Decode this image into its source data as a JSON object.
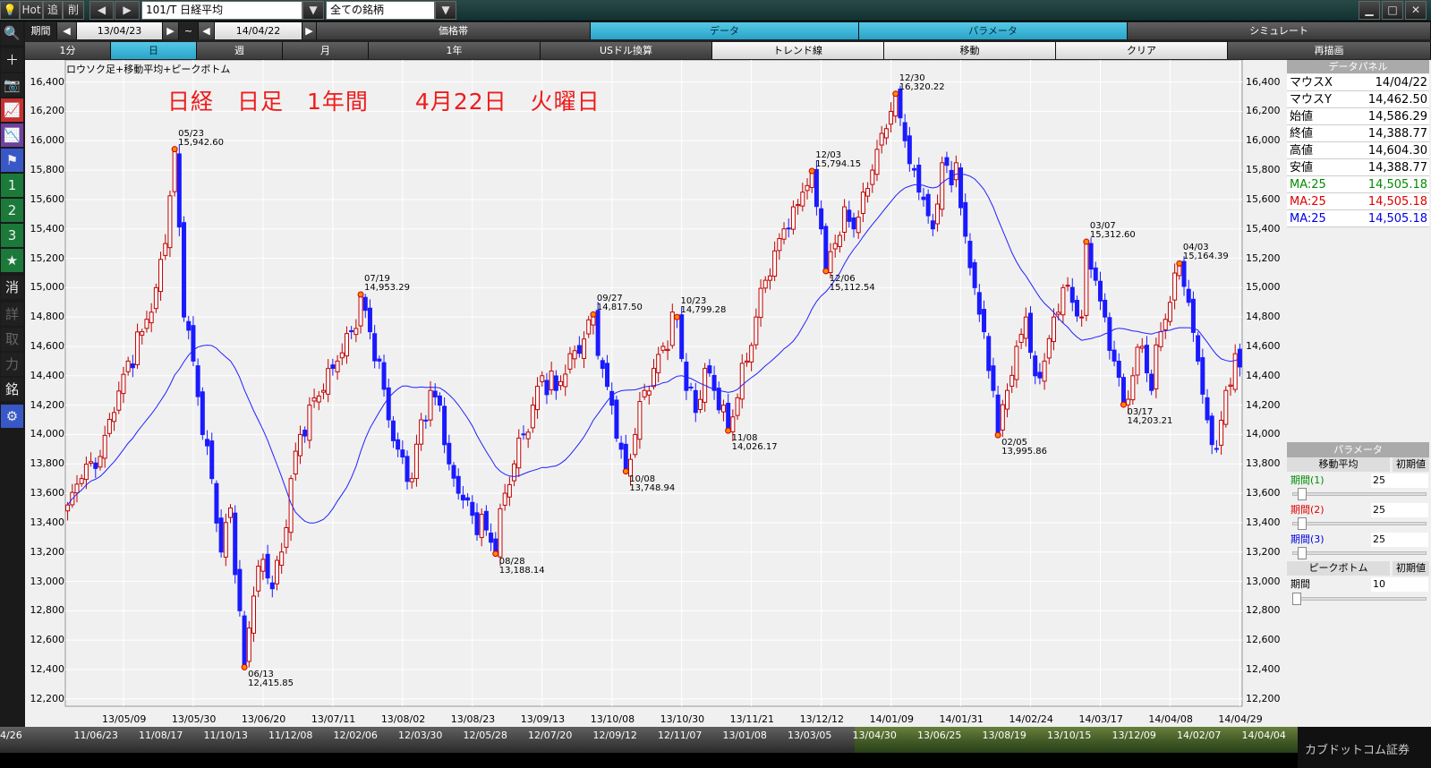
{
  "topbar": {
    "hot": "Hot",
    "add": "追",
    "del": "削",
    "symbol": "101/T 日経平均",
    "filter": "全ての銘柄"
  },
  "period": {
    "label": "期間",
    "start": "13/04/23",
    "tilde": "~",
    "end": "14/04/22"
  },
  "tabs": [
    "価格帯",
    "データ",
    "パラメータ",
    "シミュレート"
  ],
  "tabs_active": "データ",
  "timeframes": [
    "1分",
    "日",
    "週",
    "月",
    "1年",
    "USドル換算",
    "トレンド線",
    "移動",
    "クリア",
    "再描画"
  ],
  "timeframes_active": "日",
  "left_tools": [
    "🔍",
    "+",
    "📷",
    "",
    "",
    "",
    "1",
    "2",
    "3",
    "★",
    "消",
    "詳",
    "取",
    "力",
    "銘",
    "⚙"
  ],
  "chart_title": "ロウソク足+移動平均+ピークボトム",
  "big_title": "日経　日足　1年間　　4月22日　火曜日",
  "data_panel": {
    "header": "データパネル",
    "rows": [
      {
        "k": "マウスX",
        "v": "14/04/22",
        "c": "#000000"
      },
      {
        "k": "マウスY",
        "v": "14,462.50",
        "c": "#000000"
      },
      {
        "k": "始値",
        "v": "14,586.29",
        "c": "#000000"
      },
      {
        "k": "終値",
        "v": "14,388.77",
        "c": "#000000"
      },
      {
        "k": "高値",
        "v": "14,604.30",
        "c": "#000000"
      },
      {
        "k": "安値",
        "v": "14,388.77",
        "c": "#000000"
      },
      {
        "k": "MA:25",
        "v": "14,505.18",
        "c": "#008c00"
      },
      {
        "k": "MA:25",
        "v": "14,505.18",
        "c": "#e00000"
      },
      {
        "k": "MA:25",
        "v": "14,505.18",
        "c": "#0000e0"
      }
    ]
  },
  "param_panel": {
    "header": "パラメータ",
    "ma_label": "移動平均",
    "reset": "初期値",
    "p1_label": "期間(1)",
    "p1": "25",
    "p2_label": "期間(2)",
    "p2": "25",
    "p3_label": "期間(3)",
    "p3": "25",
    "pb_label": "ピークボトム",
    "pb_reset": "初期値",
    "pb_period_label": "期間",
    "pb_period": "10"
  },
  "brand": "カブドットコム証券",
  "bottom_nav": [
    "4/26",
    "11/06/23",
    "11/08/17",
    "11/10/13",
    "11/12/08",
    "12/02/06",
    "12/03/30",
    "12/05/28",
    "12/07/20",
    "12/09/12",
    "12/11/07",
    "13/01/08",
    "13/03/05",
    "13/04/30",
    "13/06/25",
    "13/08/19",
    "13/10/15",
    "13/12/09",
    "14/02/07",
    "14/04/04"
  ],
  "chart_data": {
    "type": "candlestick",
    "ma_period": 25,
    "ylim": [
      12150,
      16550
    ],
    "y_ticks": [
      12200,
      12400,
      12600,
      12800,
      13000,
      13200,
      13400,
      13600,
      13800,
      14000,
      14200,
      14400,
      14600,
      14800,
      15000,
      15200,
      15400,
      15600,
      15800,
      16000,
      16200,
      16400
    ],
    "y_tick_labels": [
      "12,200",
      "12,400",
      "12,600",
      "12,800",
      "13,000",
      "13,200",
      "13,400",
      "13,600",
      "13,800",
      "14,000",
      "14,200",
      "14,400",
      "14,600",
      "14,800",
      "15,000",
      "15,200",
      "15,400",
      "15,600",
      "15,800",
      "16,000",
      "16,200",
      "16,400"
    ],
    "x_tick_labels": [
      "13/05/09",
      "13/05/30",
      "13/06/20",
      "13/07/11",
      "13/08/02",
      "13/08/23",
      "13/09/13",
      "13/10/08",
      "13/10/30",
      "13/11/21",
      "13/12/12",
      "14/01/09",
      "14/01/31",
      "14/02/24",
      "14/03/17",
      "14/04/08",
      "14/04/29"
    ],
    "x_tick_days": [
      12,
      27,
      42,
      57,
      72,
      87,
      102,
      117,
      132,
      147,
      162,
      177,
      192,
      207,
      222,
      237,
      252
    ],
    "n_days": 253,
    "peaks": [
      {
        "day": 23,
        "date": "05/23",
        "value": 15942.6,
        "label": "15,942.60",
        "type": "peak"
      },
      {
        "day": 38,
        "date": "06/13",
        "value": 12415.85,
        "label": "12,415.85",
        "type": "bottom"
      },
      {
        "day": 63,
        "date": "07/19",
        "value": 14953.29,
        "label": "14,953.29",
        "type": "peak"
      },
      {
        "day": 92,
        "date": "08/28",
        "value": 13188.14,
        "label": "13,188.14",
        "type": "bottom"
      },
      {
        "day": 113,
        "date": "09/27",
        "value": 14817.5,
        "label": "14,817.50",
        "type": "peak"
      },
      {
        "day": 120,
        "date": "10/08",
        "value": 13748.94,
        "label": "13,748.94",
        "type": "bottom"
      },
      {
        "day": 131,
        "date": "10/23",
        "value": 14799.28,
        "label": "14,799.28",
        "type": "peak"
      },
      {
        "day": 142,
        "date": "11/08",
        "value": 14026.17,
        "label": "14,026.17",
        "type": "bottom"
      },
      {
        "day": 160,
        "date": "12/03",
        "value": 15794.15,
        "label": "15,794.15",
        "type": "peak"
      },
      {
        "day": 163,
        "date": "12/06",
        "value": 15112.54,
        "label": "15,112.54",
        "type": "bottom"
      },
      {
        "day": 178,
        "date": "12/30",
        "value": 16320.22,
        "label": "16,320.22",
        "type": "peak"
      },
      {
        "day": 200,
        "date": "02/05",
        "value": 13995.86,
        "label": "13,995.86",
        "type": "bottom"
      },
      {
        "day": 219,
        "date": "03/07",
        "value": 15312.6,
        "label": "15,312.60",
        "type": "peak"
      },
      {
        "day": 227,
        "date": "03/17",
        "value": 14203.21,
        "label": "14,203.21",
        "type": "bottom"
      },
      {
        "day": 239,
        "date": "04/03",
        "value": 15164.39,
        "label": "15,164.39",
        "type": "peak"
      }
    ],
    "anchors": [
      [
        0,
        13520
      ],
      [
        3,
        13700
      ],
      [
        7,
        13850
      ],
      [
        10,
        14150
      ],
      [
        13,
        14500
      ],
      [
        16,
        14700
      ],
      [
        19,
        15000
      ],
      [
        21,
        15300
      ],
      [
        23,
        15940
      ],
      [
        25,
        14800
      ],
      [
        27,
        14500
      ],
      [
        29,
        14000
      ],
      [
        31,
        13700
      ],
      [
        33,
        13200
      ],
      [
        35,
        13500
      ],
      [
        37,
        12800
      ],
      [
        38,
        12420
      ],
      [
        40,
        12900
      ],
      [
        42,
        13150
      ],
      [
        44,
        12950
      ],
      [
        46,
        13200
      ],
      [
        48,
        13700
      ],
      [
        50,
        14000
      ],
      [
        52,
        14200
      ],
      [
        55,
        14300
      ],
      [
        58,
        14500
      ],
      [
        61,
        14700
      ],
      [
        63,
        14950
      ],
      [
        65,
        14700
      ],
      [
        67,
        14500
      ],
      [
        69,
        14100
      ],
      [
        71,
        13900
      ],
      [
        74,
        13700
      ],
      [
        76,
        14100
      ],
      [
        78,
        14300
      ],
      [
        80,
        14200
      ],
      [
        82,
        13800
      ],
      [
        84,
        13600
      ],
      [
        87,
        13450
      ],
      [
        90,
        13350
      ],
      [
        92,
        13190
      ],
      [
        94,
        13600
      ],
      [
        96,
        13800
      ],
      [
        98,
        14000
      ],
      [
        100,
        14200
      ],
      [
        102,
        14400
      ],
      [
        105,
        14300
      ],
      [
        108,
        14550
      ],
      [
        111,
        14650
      ],
      [
        113,
        14810
      ],
      [
        115,
        14450
      ],
      [
        117,
        14200
      ],
      [
        119,
        13900
      ],
      [
        120,
        13750
      ],
      [
        122,
        14000
      ],
      [
        124,
        14300
      ],
      [
        126,
        14450
      ],
      [
        128,
        14600
      ],
      [
        131,
        14790
      ],
      [
        133,
        14300
      ],
      [
        135,
        14150
      ],
      [
        137,
        14450
      ],
      [
        139,
        14300
      ],
      [
        141,
        14200
      ],
      [
        142,
        14030
      ],
      [
        144,
        14250
      ],
      [
        146,
        14500
      ],
      [
        148,
        14800
      ],
      [
        150,
        15050
      ],
      [
        152,
        15250
      ],
      [
        154,
        15400
      ],
      [
        156,
        15550
      ],
      [
        158,
        15650
      ],
      [
        160,
        15790
      ],
      [
        162,
        15400
      ],
      [
        163,
        15120
      ],
      [
        165,
        15300
      ],
      [
        167,
        15550
      ],
      [
        169,
        15400
      ],
      [
        171,
        15650
      ],
      [
        173,
        15800
      ],
      [
        175,
        16050
      ],
      [
        177,
        16200
      ],
      [
        178,
        16320
      ],
      [
        180,
        16000
      ],
      [
        182,
        15800
      ],
      [
        184,
        15600
      ],
      [
        186,
        15400
      ],
      [
        188,
        15850
      ],
      [
        190,
        15700
      ],
      [
        191,
        15850
      ],
      [
        193,
        15350
      ],
      [
        195,
        15000
      ],
      [
        197,
        14700
      ],
      [
        199,
        14300
      ],
      [
        200,
        14000
      ],
      [
        202,
        14300
      ],
      [
        204,
        14600
      ],
      [
        206,
        14800
      ],
      [
        208,
        14400
      ],
      [
        210,
        14500
      ],
      [
        212,
        14800
      ],
      [
        214,
        15000
      ],
      [
        216,
        14900
      ],
      [
        218,
        14800
      ],
      [
        219,
        15310
      ],
      [
        221,
        15050
      ],
      [
        223,
        14800
      ],
      [
        225,
        14500
      ],
      [
        227,
        14200
      ],
      [
        229,
        14400
      ],
      [
        231,
        14600
      ],
      [
        233,
        14300
      ],
      [
        235,
        14700
      ],
      [
        237,
        14900
      ],
      [
        239,
        15160
      ],
      [
        241,
        14900
      ],
      [
        243,
        14500
      ],
      [
        245,
        14100
      ],
      [
        247,
        13900
      ],
      [
        249,
        14300
      ],
      [
        251,
        14550
      ],
      [
        252,
        14460
      ]
    ]
  }
}
